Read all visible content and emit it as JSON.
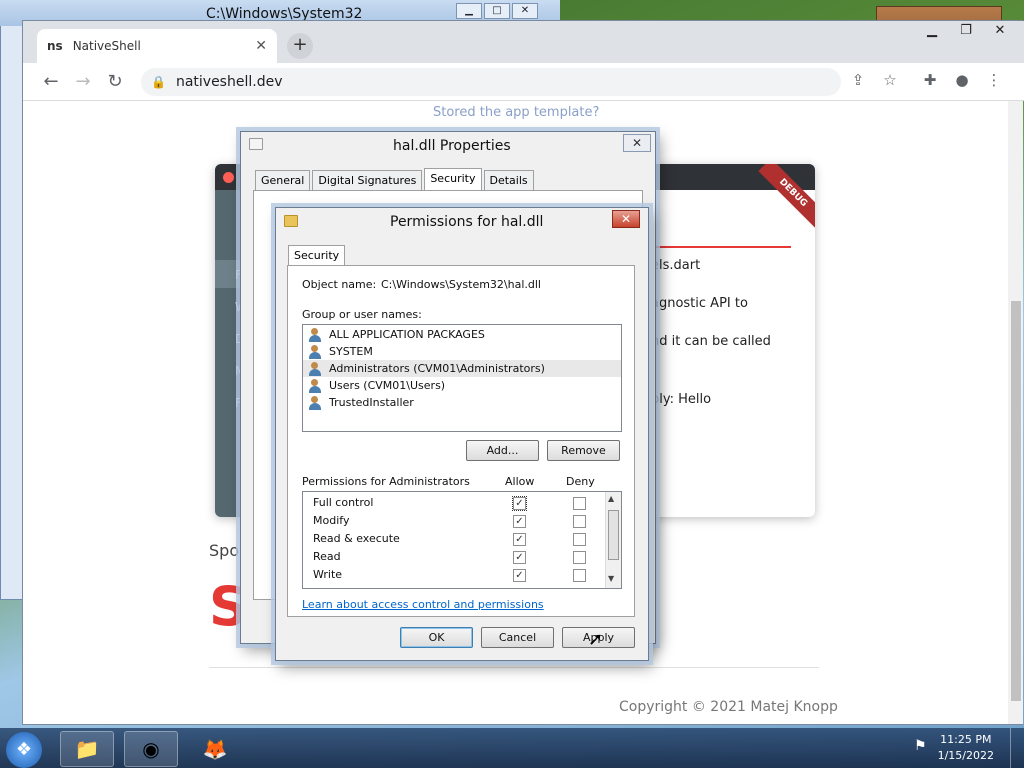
{
  "background": {
    "explorer_title": "C:\\Windows\\System32"
  },
  "browser": {
    "tab_favicon": "ns",
    "tab_title": "NativeShell",
    "url": "nativeshell.dev",
    "icons": [
      "back-icon",
      "forward-icon",
      "reload-icon",
      "lock-icon",
      "share-icon",
      "star-icon",
      "extensions-icon",
      "profile-icon",
      "menu-icon"
    ]
  },
  "page": {
    "faded_heading": "Stored the app template?",
    "debug_banner": "DEBUG",
    "right_lines": [
      "els.dart",
      "agnostic API to",
      "nd it can be called",
      "ply: Hello"
    ],
    "sponsor": "Spo",
    "big_letter": "S",
    "copyright": "Copyright © 2021 Matej Knopp"
  },
  "props_dialog": {
    "title": "hal.dll Properties",
    "tabs": [
      "General",
      "Digital Signatures",
      "Security",
      "Details"
    ],
    "selected_tab": "Security"
  },
  "perm_dialog": {
    "title": "Permissions for hal.dll",
    "tab": "Security",
    "object_label": "Object name:",
    "object_value": "C:\\Windows\\System32\\hal.dll",
    "group_label": "Group or user names:",
    "users": [
      "ALL APPLICATION PACKAGES",
      "SYSTEM",
      "Administrators (CVM01\\Administrators)",
      "Users (CVM01\\Users)",
      "TrustedInstaller"
    ],
    "add_label": "Add...",
    "remove_label": "Remove",
    "perm_label": "Permissions for Administrators",
    "allow_label": "Allow",
    "deny_label": "Deny",
    "permissions": [
      {
        "name": "Full control",
        "allow": true,
        "deny": false
      },
      {
        "name": "Modify",
        "allow": true,
        "deny": false
      },
      {
        "name": "Read & execute",
        "allow": true,
        "deny": false
      },
      {
        "name": "Read",
        "allow": true,
        "deny": false
      },
      {
        "name": "Write",
        "allow": true,
        "deny": false
      }
    ],
    "link": "Learn about access control and permissions",
    "ok_label": "OK",
    "cancel_label": "Cancel",
    "apply_label": "Apply"
  },
  "taskbar": {
    "time": "11:25 PM",
    "date": "1/15/2022"
  }
}
